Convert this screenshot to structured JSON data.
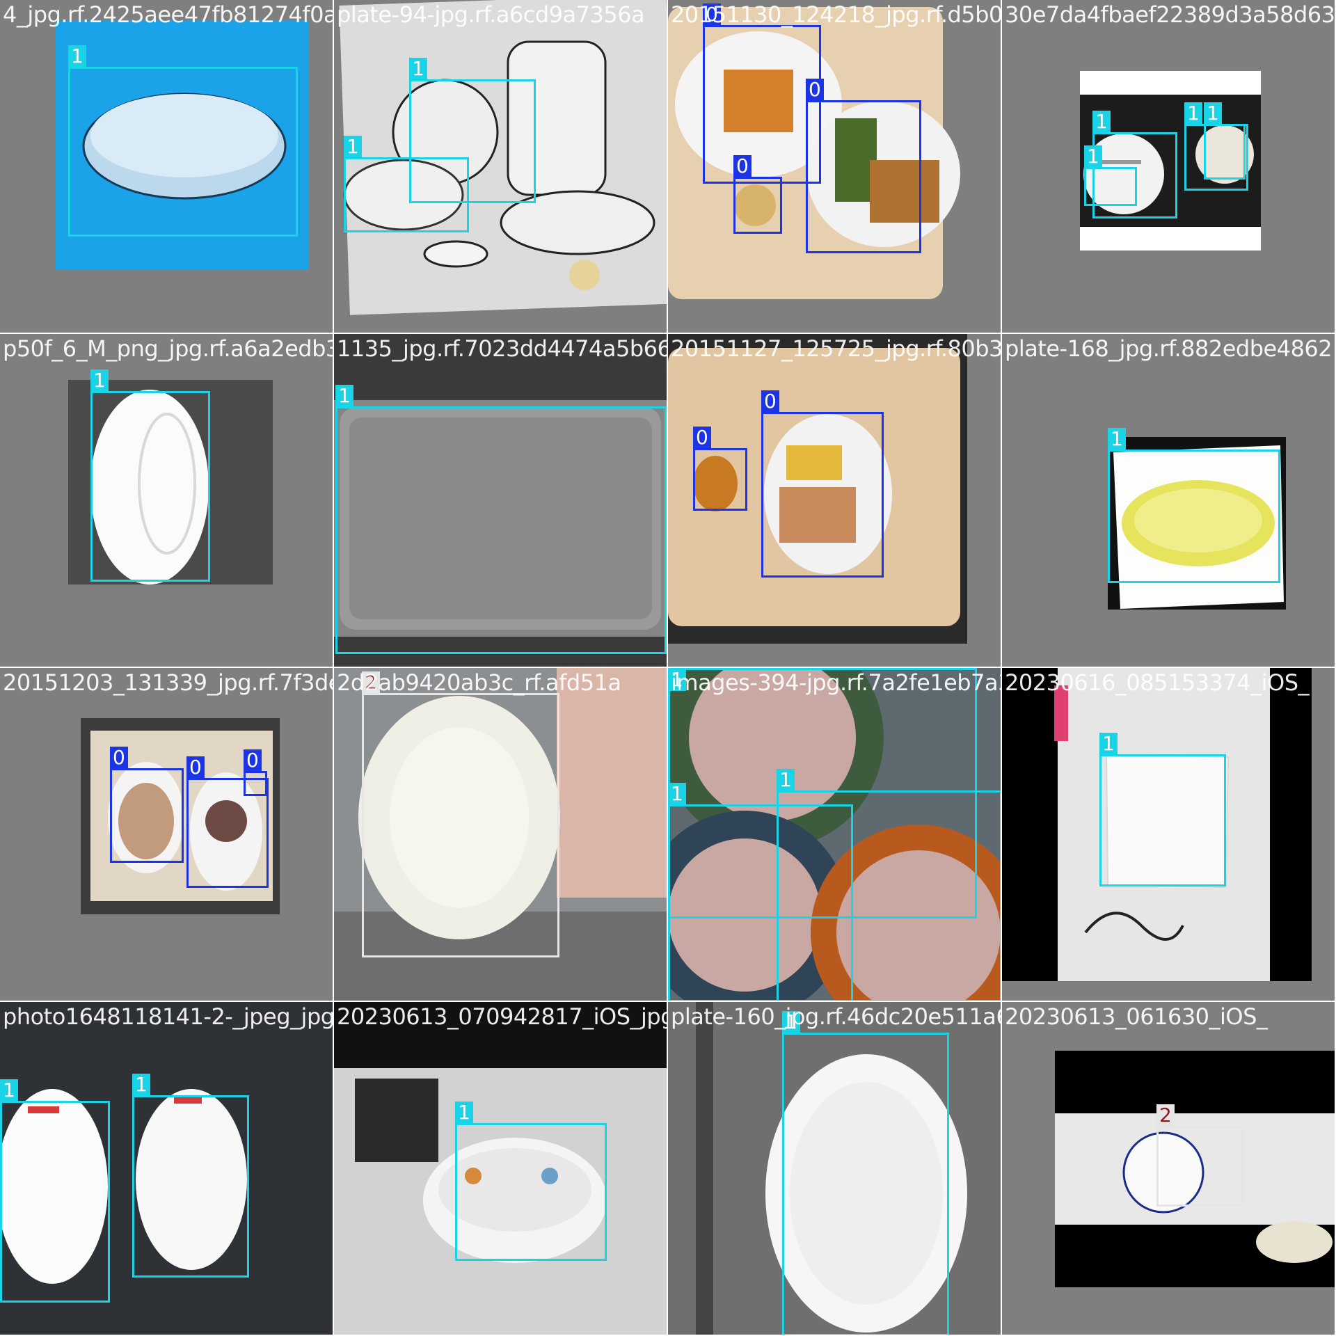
{
  "mosaic": {
    "tiles": [
      {
        "id": "t0",
        "filename": "4_jpg.rf.2425aee47fb81274f0ateef4bde23ba6cd9a7356a",
        "boxes": [
          {
            "cls": "1"
          }
        ]
      },
      {
        "id": "t1",
        "filename": "plate-94-jpg.rf.a6cd9a7356a",
        "boxes": [
          {
            "cls": "1"
          },
          {
            "cls": "1"
          }
        ]
      },
      {
        "id": "t2",
        "filename": "20151130_124218_jpg.rf.d5b0e7da4fbaef22389d3a58d6",
        "boxes": [
          {
            "cls": "0"
          },
          {
            "cls": "0"
          },
          {
            "cls": "0"
          }
        ]
      },
      {
        "id": "t3",
        "filename": "30e7da4fbaef22389d3a58d63",
        "boxes": [
          {
            "cls": "1"
          },
          {
            "cls": "1"
          },
          {
            "cls": "1"
          },
          {
            "cls": "1"
          }
        ]
      },
      {
        "id": "t4",
        "filename": "p50f_6_M_png_jpg.rf.a6a2edb35ba807023dd4474a5b66",
        "boxes": [
          {
            "cls": "1"
          }
        ]
      },
      {
        "id": "t5",
        "filename": "1135_jpg.rf.7023dd4474a5b66",
        "boxes": [
          {
            "cls": "1"
          }
        ]
      },
      {
        "id": "t6",
        "filename": "20151127_125725_jpg.rf.80b3617468f7b8882edbe4862",
        "boxes": [
          {
            "cls": "0"
          },
          {
            "cls": "0"
          }
        ]
      },
      {
        "id": "t7",
        "filename": "plate-168_jpg.rf.882edbe4862",
        "boxes": [
          {
            "cls": "1"
          }
        ]
      },
      {
        "id": "t8",
        "filename": "20151203_131339_jpg.rf.7f3de2ab9ea2eab3c_rf.afd51a",
        "boxes": [
          {
            "cls": "0"
          },
          {
            "cls": "0"
          },
          {
            "cls": "0"
          }
        ]
      },
      {
        "id": "t9",
        "filename": "2d2ab9420ab3c_rf.afd51a",
        "boxes": [
          {
            "cls": "2"
          }
        ]
      },
      {
        "id": "t10",
        "filename": "images-394-jpg.rf.7a2fe1eb7a3e3",
        "boxes": [
          {
            "cls": "1"
          },
          {
            "cls": "1"
          },
          {
            "cls": "1"
          }
        ]
      },
      {
        "id": "t11",
        "filename": "20230616_085153374_iOS_",
        "boxes": [
          {
            "cls": "1"
          }
        ]
      },
      {
        "id": "t12",
        "filename": "photo1648118141-2-_jpeg_jpg.rf.3d8bc6729",
        "boxes": [
          {
            "cls": "1"
          },
          {
            "cls": "1"
          }
        ]
      },
      {
        "id": "t13",
        "filename": "20230613_070942817_iOS_jpg.rf.3c0935cb4",
        "boxes": [
          {
            "cls": "1"
          }
        ]
      },
      {
        "id": "t14",
        "filename": "plate-160_jpg.rf.46dc20e511a66173d",
        "boxes": [
          {
            "cls": "1"
          }
        ]
      },
      {
        "id": "t15",
        "filename": "20230613_061630_iOS_",
        "boxes": [
          {
            "cls": "2"
          }
        ]
      }
    ]
  },
  "colors": {
    "class0": "#1a34e6",
    "class1": "#19d4e6",
    "class2": "#e6e6e6",
    "background": "#808080"
  }
}
